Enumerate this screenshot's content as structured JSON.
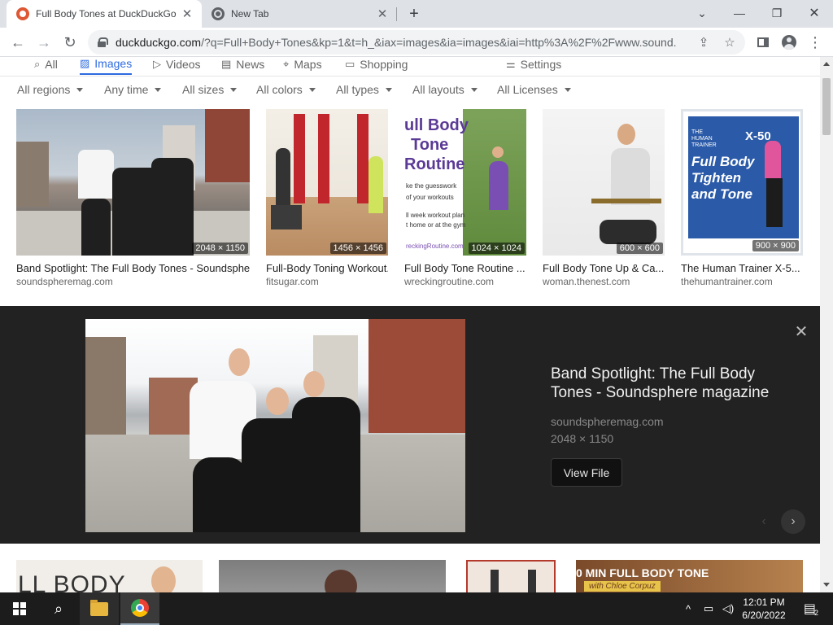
{
  "browser": {
    "tabs": [
      {
        "title": "Full Body Tones at DuckDuckGo"
      },
      {
        "title": "New Tab"
      }
    ],
    "url_host": "duckduckgo.com",
    "url_rest": "/?q=Full+Body+Tones&kp=1&t=h_&iax=images&ia=images&iai=http%3A%2F%2Fwww.sound..."
  },
  "verticals": [
    {
      "label": "All",
      "icon": "search-icon"
    },
    {
      "label": "Images",
      "icon": "image-icon",
      "active": true
    },
    {
      "label": "Videos",
      "icon": "play-icon"
    },
    {
      "label": "News",
      "icon": "news-icon"
    },
    {
      "label": "Maps",
      "icon": "map-pin-icon"
    },
    {
      "label": "Shopping",
      "icon": "bag-icon"
    },
    {
      "label": "Settings",
      "icon": "sliders-icon"
    }
  ],
  "filters": [
    "All regions",
    "Any time",
    "All sizes",
    "All colors",
    "All types",
    "All layouts",
    "All Licenses"
  ],
  "results": [
    {
      "title": "Band Spotlight: The Full Body Tones - Soundsphere...",
      "source": "soundspheremag.com",
      "dims": "2048 × 1150"
    },
    {
      "title": "Full-Body Toning Workout...",
      "source": "fitsugar.com",
      "dims": "1456 × 1456"
    },
    {
      "title": "Full Body Tone Routine ...",
      "source": "wreckingroutine.com",
      "dims": "1024 × 1024"
    },
    {
      "title": "Full Body Tone Up & Ca...",
      "source": "woman.thenest.com",
      "dims": "600 × 600"
    },
    {
      "title": "The Human Trainer X-5...",
      "source": "thehumantrainer.com",
      "dims": "900 × 900"
    }
  ],
  "thumb_text": {
    "routine_lines": [
      "ull Body",
      "Tone",
      "Routine"
    ],
    "routine_small": [
      "ke the guesswork",
      "of your workouts",
      "ll week workout plan",
      "t home or at the gym",
      "reckingRoutine.com"
    ],
    "x50_lines": [
      "Full Body",
      "Tighten",
      "and Tone"
    ],
    "x50_brand": "THE HUMAN TRAINER",
    "x50_model": "X-50"
  },
  "detail": {
    "title": "Band Spotlight: The Full Body Tones - Soundsphere magazine",
    "source": "soundspheremag.com",
    "dims": "2048 × 1150",
    "button": "View File"
  },
  "row2": {
    "tile1_text": "LL BODY",
    "tile4_text": "0 MIN FULL BODY TONE",
    "tile4_sub": "with Chloe Corpuz"
  },
  "taskbar": {
    "time": "12:01 PM",
    "date": "6/20/2022",
    "notifications": "2"
  },
  "colors": {
    "accent": "#2d6ae0",
    "detail_bg": "#222222",
    "taskbar_bg": "#1c1c1c"
  }
}
